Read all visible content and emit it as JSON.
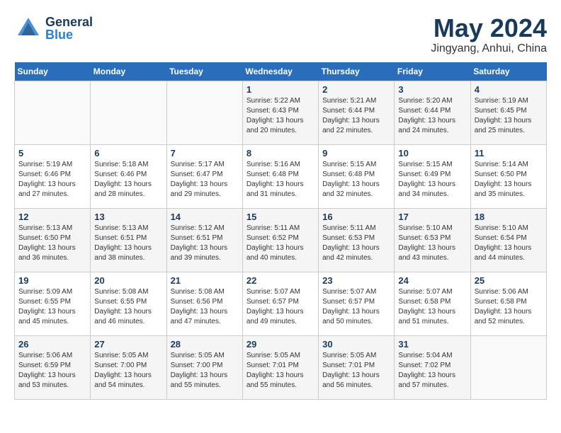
{
  "header": {
    "logo_general": "General",
    "logo_blue": "Blue",
    "month_title": "May 2024",
    "location": "Jingyang, Anhui, China"
  },
  "weekdays": [
    "Sunday",
    "Monday",
    "Tuesday",
    "Wednesday",
    "Thursday",
    "Friday",
    "Saturday"
  ],
  "weeks": [
    [
      {
        "day": "",
        "info": ""
      },
      {
        "day": "",
        "info": ""
      },
      {
        "day": "",
        "info": ""
      },
      {
        "day": "1",
        "info": "Sunrise: 5:22 AM\nSunset: 6:43 PM\nDaylight: 13 hours\nand 20 minutes."
      },
      {
        "day": "2",
        "info": "Sunrise: 5:21 AM\nSunset: 6:44 PM\nDaylight: 13 hours\nand 22 minutes."
      },
      {
        "day": "3",
        "info": "Sunrise: 5:20 AM\nSunset: 6:44 PM\nDaylight: 13 hours\nand 24 minutes."
      },
      {
        "day": "4",
        "info": "Sunrise: 5:19 AM\nSunset: 6:45 PM\nDaylight: 13 hours\nand 25 minutes."
      }
    ],
    [
      {
        "day": "5",
        "info": "Sunrise: 5:19 AM\nSunset: 6:46 PM\nDaylight: 13 hours\nand 27 minutes."
      },
      {
        "day": "6",
        "info": "Sunrise: 5:18 AM\nSunset: 6:46 PM\nDaylight: 13 hours\nand 28 minutes."
      },
      {
        "day": "7",
        "info": "Sunrise: 5:17 AM\nSunset: 6:47 PM\nDaylight: 13 hours\nand 29 minutes."
      },
      {
        "day": "8",
        "info": "Sunrise: 5:16 AM\nSunset: 6:48 PM\nDaylight: 13 hours\nand 31 minutes."
      },
      {
        "day": "9",
        "info": "Sunrise: 5:15 AM\nSunset: 6:48 PM\nDaylight: 13 hours\nand 32 minutes."
      },
      {
        "day": "10",
        "info": "Sunrise: 5:15 AM\nSunset: 6:49 PM\nDaylight: 13 hours\nand 34 minutes."
      },
      {
        "day": "11",
        "info": "Sunrise: 5:14 AM\nSunset: 6:50 PM\nDaylight: 13 hours\nand 35 minutes."
      }
    ],
    [
      {
        "day": "12",
        "info": "Sunrise: 5:13 AM\nSunset: 6:50 PM\nDaylight: 13 hours\nand 36 minutes."
      },
      {
        "day": "13",
        "info": "Sunrise: 5:13 AM\nSunset: 6:51 PM\nDaylight: 13 hours\nand 38 minutes."
      },
      {
        "day": "14",
        "info": "Sunrise: 5:12 AM\nSunset: 6:51 PM\nDaylight: 13 hours\nand 39 minutes."
      },
      {
        "day": "15",
        "info": "Sunrise: 5:11 AM\nSunset: 6:52 PM\nDaylight: 13 hours\nand 40 minutes."
      },
      {
        "day": "16",
        "info": "Sunrise: 5:11 AM\nSunset: 6:53 PM\nDaylight: 13 hours\nand 42 minutes."
      },
      {
        "day": "17",
        "info": "Sunrise: 5:10 AM\nSunset: 6:53 PM\nDaylight: 13 hours\nand 43 minutes."
      },
      {
        "day": "18",
        "info": "Sunrise: 5:10 AM\nSunset: 6:54 PM\nDaylight: 13 hours\nand 44 minutes."
      }
    ],
    [
      {
        "day": "19",
        "info": "Sunrise: 5:09 AM\nSunset: 6:55 PM\nDaylight: 13 hours\nand 45 minutes."
      },
      {
        "day": "20",
        "info": "Sunrise: 5:08 AM\nSunset: 6:55 PM\nDaylight: 13 hours\nand 46 minutes."
      },
      {
        "day": "21",
        "info": "Sunrise: 5:08 AM\nSunset: 6:56 PM\nDaylight: 13 hours\nand 47 minutes."
      },
      {
        "day": "22",
        "info": "Sunrise: 5:07 AM\nSunset: 6:57 PM\nDaylight: 13 hours\nand 49 minutes."
      },
      {
        "day": "23",
        "info": "Sunrise: 5:07 AM\nSunset: 6:57 PM\nDaylight: 13 hours\nand 50 minutes."
      },
      {
        "day": "24",
        "info": "Sunrise: 5:07 AM\nSunset: 6:58 PM\nDaylight: 13 hours\nand 51 minutes."
      },
      {
        "day": "25",
        "info": "Sunrise: 5:06 AM\nSunset: 6:58 PM\nDaylight: 13 hours\nand 52 minutes."
      }
    ],
    [
      {
        "day": "26",
        "info": "Sunrise: 5:06 AM\nSunset: 6:59 PM\nDaylight: 13 hours\nand 53 minutes."
      },
      {
        "day": "27",
        "info": "Sunrise: 5:05 AM\nSunset: 7:00 PM\nDaylight: 13 hours\nand 54 minutes."
      },
      {
        "day": "28",
        "info": "Sunrise: 5:05 AM\nSunset: 7:00 PM\nDaylight: 13 hours\nand 55 minutes."
      },
      {
        "day": "29",
        "info": "Sunrise: 5:05 AM\nSunset: 7:01 PM\nDaylight: 13 hours\nand 55 minutes."
      },
      {
        "day": "30",
        "info": "Sunrise: 5:05 AM\nSunset: 7:01 PM\nDaylight: 13 hours\nand 56 minutes."
      },
      {
        "day": "31",
        "info": "Sunrise: 5:04 AM\nSunset: 7:02 PM\nDaylight: 13 hours\nand 57 minutes."
      },
      {
        "day": "",
        "info": ""
      }
    ]
  ]
}
